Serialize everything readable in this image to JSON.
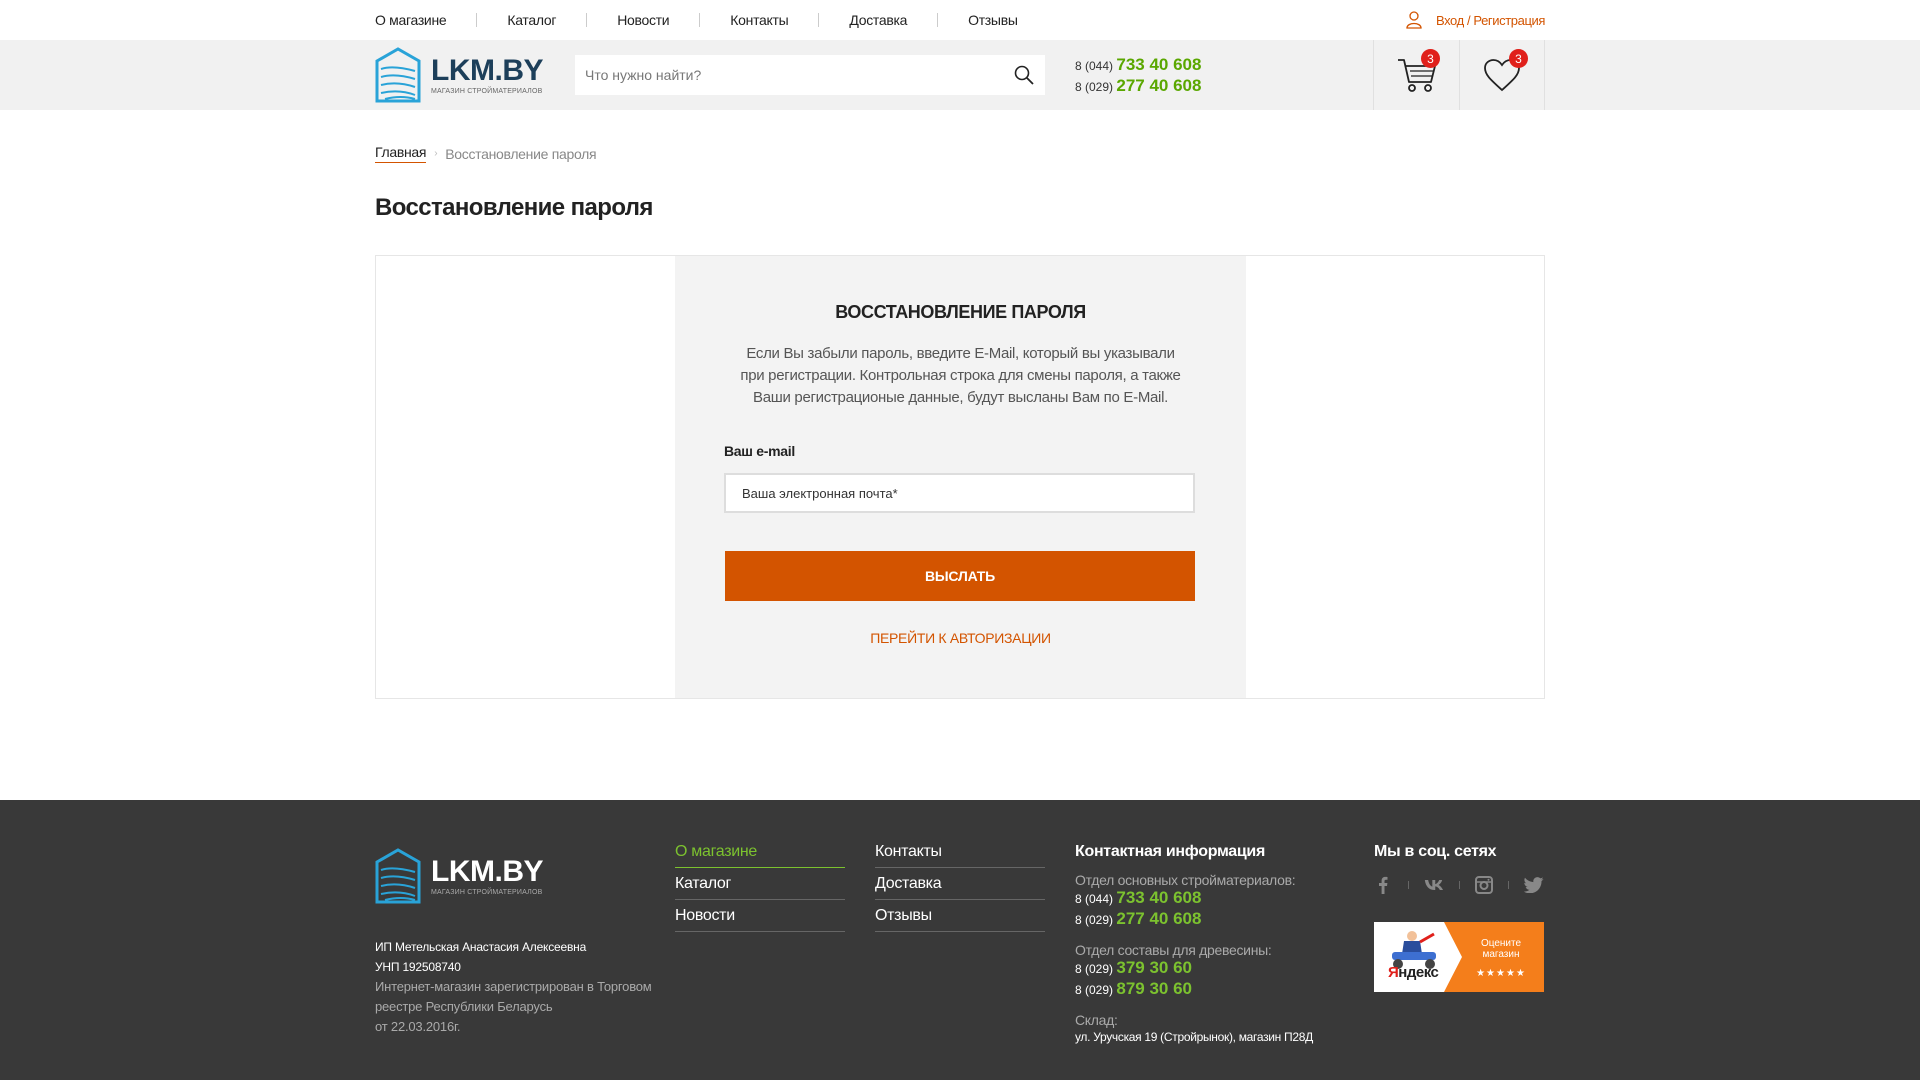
{
  "topnav": {
    "items": [
      "О магазине",
      "Каталог",
      "Новости",
      "Контакты",
      "Доставка",
      "Отзывы"
    ],
    "login_label": "Вход / Регистрация"
  },
  "header": {
    "logo_title": "LKM.BY",
    "logo_subtitle": "МАГАЗИН СТРОЙМАТЕРИАЛОВ",
    "search_placeholder": "Что нужно найти?",
    "phone1_prefix": "8 (044)",
    "phone1_number": "733 40 608",
    "phone2_prefix": "8 (029)",
    "phone2_number": "277 40 608",
    "cart_count": "3",
    "favorites_count": "3"
  },
  "breadcrumb": {
    "home": "Главная",
    "current": "Восстановление пароля"
  },
  "page_title": "Восстановление пароля",
  "form": {
    "title": "ВОССТАНОВЛЕНИЕ ПАРОЛЯ",
    "description": "Если Вы забыли пароль, введите E-Mail, который вы указывали при регистрации. Контрольная строка для смены пароля, а также Ваши регистрационые данные, будут высланы Вам по E-Mail.",
    "email_label": "Ваш e-mail",
    "email_placeholder": "Ваша электронная почта*",
    "submit_label": "ВЫСЛАТЬ",
    "auth_link": "ПЕРЕЙТИ К АВТОРИЗАЦИИ"
  },
  "footer": {
    "logo_title": "LKM.BY",
    "logo_subtitle": "МАГАЗИН СТРОЙМАТЕРИАЛОВ",
    "legal_name": "ИП Метельская Анастасия Алексеевна",
    "unp": "УНП 192508740",
    "registry_line1": "Интернет-магазин зарегистрирован в Торговом",
    "registry_line2": "реестре Республики Беларусь",
    "registry_line3": "от 22.03.2016г.",
    "menu_col1": [
      "О магазине",
      "Каталог",
      "Новости"
    ],
    "menu_col2": [
      "Контакты",
      "Доставка",
      "Отзывы"
    ],
    "contacts_title": "Контактная информация",
    "dept1": "Отдел основных стройматериалов:",
    "dept1_phone1_prefix": "8 (044)",
    "dept1_phone1_number": "733 40 608",
    "dept1_phone2_prefix": "8 (029)",
    "dept1_phone2_number": "277 40 608",
    "dept2": "Отдел составы для древесины:",
    "dept2_phone1_prefix": "8 (029)",
    "dept2_phone1_number": "379 30 60",
    "dept2_phone2_prefix": "8 (029)",
    "dept2_phone2_number": "879 30 60",
    "warehouse_label": "Склад:",
    "warehouse_address": "ул. Уручская 19 (Стройрынок), магазин П28Д",
    "social_title": "Мы в соц. сетях",
    "social_icons": [
      "facebook-icon",
      "vk-icon",
      "instagram-icon",
      "twitter-icon"
    ],
    "yandex_brand_first": "Я",
    "yandex_brand_rest": "ндекс",
    "yandex_rate_line1": "Оцените",
    "yandex_rate_line2": "магазин",
    "yandex_stars": "★★★★★"
  },
  "colors": {
    "accent": "#d35400",
    "phone_green": "#5aa700",
    "footer_bg": "#393939",
    "footer_green": "#7cc22f",
    "badge_red": "#e0201b"
  }
}
